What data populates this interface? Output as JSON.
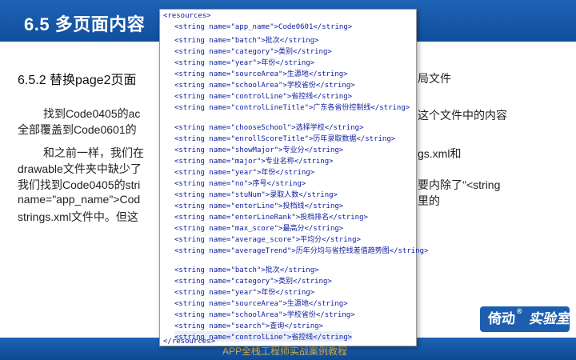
{
  "header": {
    "title": "6.5 多页面内容"
  },
  "section": {
    "subtitle": "6.5.2 替换page2页面",
    "subtitle_tail": "局文件"
  },
  "paragraphs": [
    "找到Code0405的ac",
    "全部覆盖到Code0601的",
    "和之前一样，我们在",
    "drawable文件夹中缺少了",
    "我们找到Code0405的stri",
    "name=\"app_name\">Cod",
    "strings.xml文件中。但这"
  ],
  "paragraph_tails": [
    "这个文件中的内容",
    "gs.xml和",
    "要内除了\"<string",
    "里的"
  ],
  "code_lines": [
    "<resources>",
    "<string name=\"app_name\">Code0601</string>",
    "<string name=\"batch\">批次</string>",
    "<string name=\"category\">类别</string>",
    "<string name=\"year\">年份</string>",
    "<string name=\"sourceArea\">生源地</string>",
    "<string name=\"schoolArea\">学校省份</string>",
    "<string name=\"controlLine\">省控线</string>",
    "<string name=\"controlLineTitle\">广东各省份控制线</string>",
    "<string name=\"chooseSchool\">选择学校</string>",
    "<string name=\"enrollScoreTitle\">历年录取数据</string>",
    "<string name=\"showMajor\">专业分</string>",
    "<string name=\"major\">专业名称</string>",
    "<string name=\"year\">年份</string>",
    "<string name=\"no\">序号</string>",
    "<string name=\"stuNum\">录取人数</string>",
    "<string name=\"enterLine\">投档线</string>",
    "<string name=\"enterLineRank\">投档排名</string>",
    "<string name=\"max_score\">最高分</string>",
    "<string name=\"average_score\">平均分</string>",
    "<string name=\"averageTrend\">历年分均与省控线差值趋势图</string>",
    "<string name=\"batch\">批次</string>",
    "<string name=\"category\">类别</string>",
    "<string name=\"year\">年份</string>",
    "<string name=\"sourceArea\">生源地</string>",
    "<string name=\"schoolArea\">学校省份</string>",
    "<string name=\"search\">查询</string>",
    "<string name=\"controlLine\">省控线</string>",
    "</resources>"
  ],
  "footer": {
    "text": "APP全栈工程师实战案例教程"
  },
  "logo": {
    "part1": "倚动",
    "part2": "实验室",
    "registered": "®"
  }
}
